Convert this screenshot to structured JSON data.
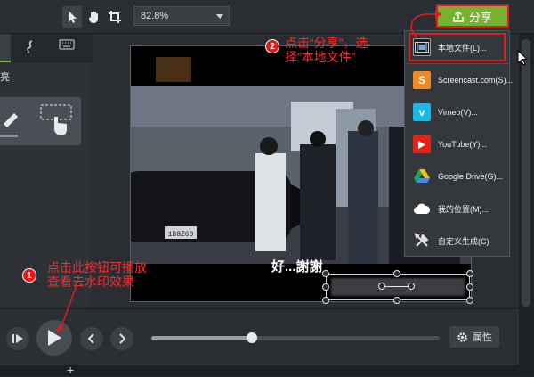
{
  "toolbar": {
    "zoom_value": "82.8%",
    "share_label": "分享",
    "tools": [
      "arrow-select",
      "pan-hand",
      "crop"
    ]
  },
  "left_panel": {
    "partial_label": "亮"
  },
  "share_menu": {
    "items": [
      {
        "label": "本地文件(L)...",
        "icon": "film-icon",
        "color": "#1a1d20"
      },
      {
        "label": "Screencast.com(S)...",
        "icon": "screencast-icon",
        "color": "#f08a24"
      },
      {
        "label": "Vimeo(V)...",
        "icon": "vimeo-icon",
        "color": "#1ab7ea"
      },
      {
        "label": "YouTube(Y)...",
        "icon": "youtube-icon",
        "color": "#e62117"
      },
      {
        "label": "Google Drive(G)...",
        "icon": "google-drive-icon",
        "color": "#f4c20d"
      },
      {
        "label": "我的位置(M)...",
        "icon": "cloud-icon",
        "color": "#ffffff"
      },
      {
        "label": "自定义生成(C)",
        "icon": "tools-icon",
        "color": "#e0e0e0"
      }
    ]
  },
  "video": {
    "subtitle": "好...謝謝",
    "plate": "1B8Z60"
  },
  "controls": {
    "progress": 0.35,
    "properties_label": "属性"
  },
  "annotations": {
    "step1_number": "1",
    "step1_text_line1": "点击此按钮可播放",
    "step1_text_line2": "查看去水印效果",
    "step2_number": "2",
    "step2_text_line1": "点击“分享”，选",
    "step2_text_line2": "择“本地文件”"
  },
  "colors": {
    "accent_green": "#74b22f",
    "annotation_red": "#e31b1b"
  }
}
